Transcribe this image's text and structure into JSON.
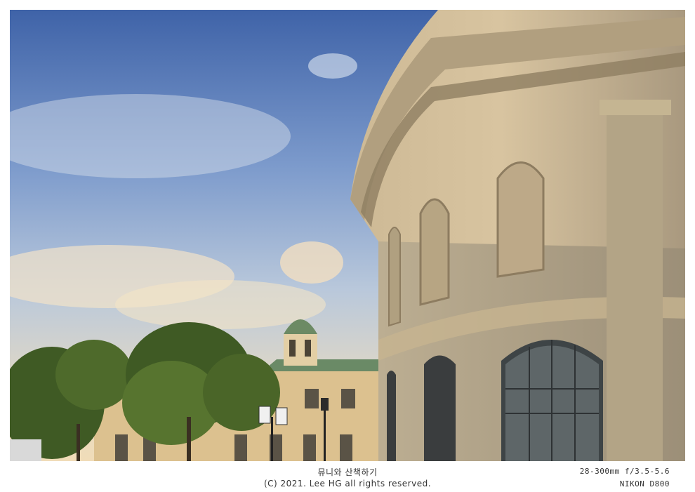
{
  "caption": {
    "title": "뮤니와 산책하기",
    "copyright": "(C) 2021. Lee HG all rights reserved."
  },
  "exif": {
    "lens": "28-300mm f/3.5-5.6",
    "camera": "NIKON D800"
  },
  "colors": {
    "sky_top": "#3f63a8",
    "sky_mid": "#a9bfd9",
    "sky_low": "#e9dcc2",
    "stone_lit": "#d6c19a",
    "stone_shade": "#a6987e",
    "dome": "#6c8a64",
    "tree": "#3f5a24"
  }
}
